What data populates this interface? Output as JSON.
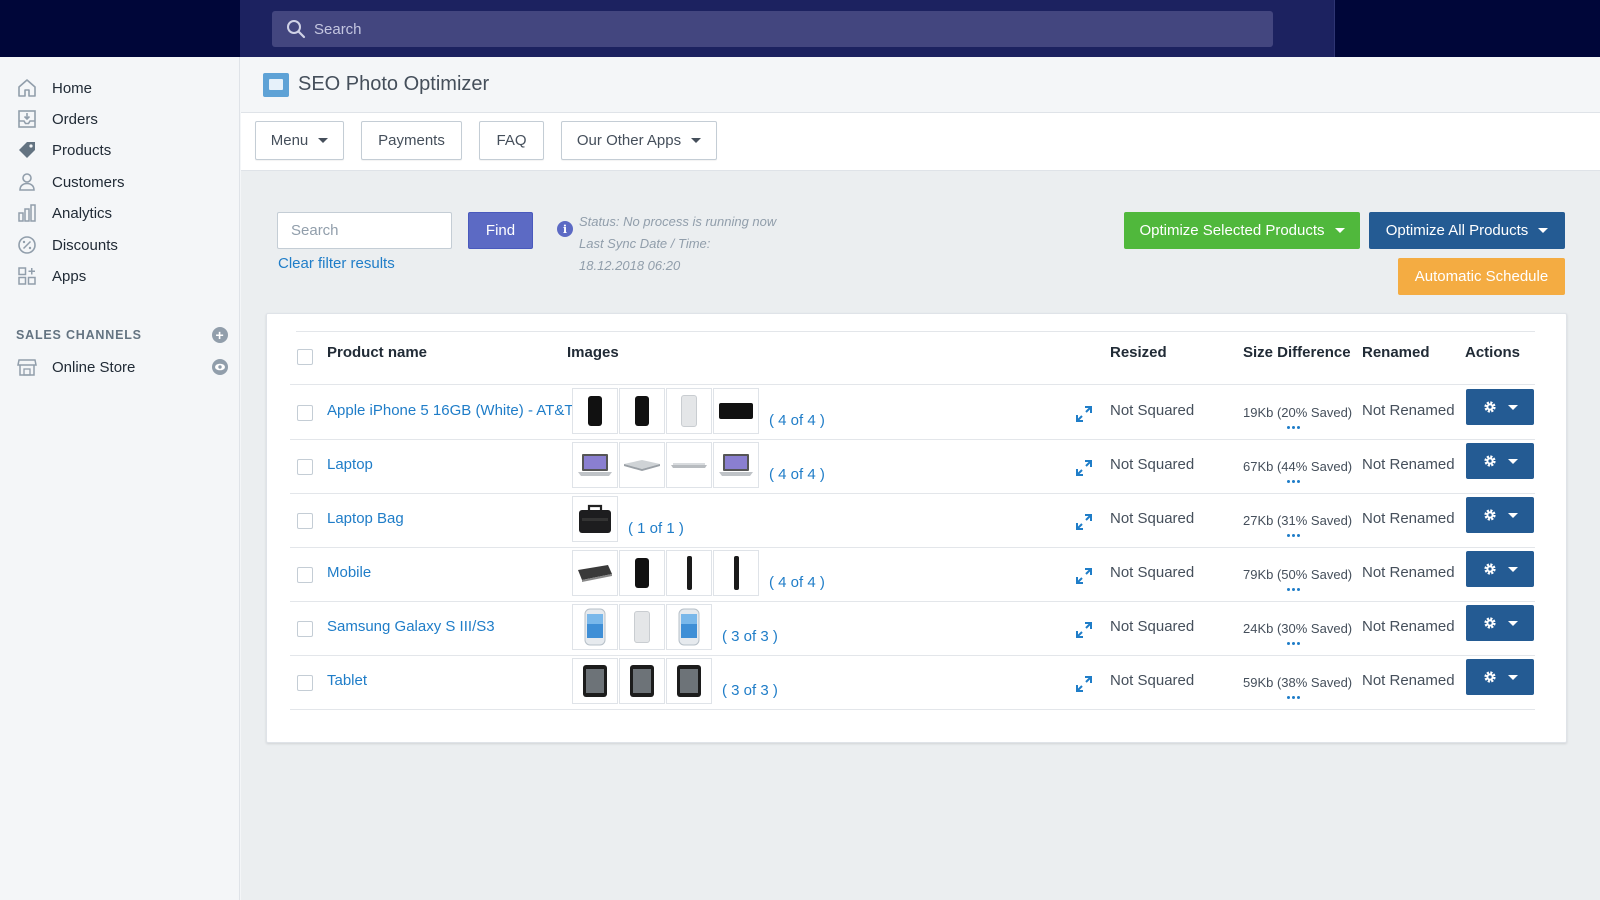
{
  "topbar": {
    "search_placeholder": "Search"
  },
  "sidebar": {
    "items": [
      {
        "label": "Home",
        "icon": "home-icon"
      },
      {
        "label": "Orders",
        "icon": "orders-icon"
      },
      {
        "label": "Products",
        "icon": "tag-icon"
      },
      {
        "label": "Customers",
        "icon": "person-icon"
      },
      {
        "label": "Analytics",
        "icon": "bar-chart-icon"
      },
      {
        "label": "Discounts",
        "icon": "discount-icon"
      },
      {
        "label": "Apps",
        "icon": "apps-icon"
      }
    ],
    "sales_channels_label": "SALES CHANNELS",
    "online_store_label": "Online Store"
  },
  "app": {
    "title": "SEO Photo Optimizer"
  },
  "tabs": {
    "menu": "Menu",
    "payments": "Payments",
    "faq": "FAQ",
    "other_apps": "Our Other Apps"
  },
  "filter": {
    "search_placeholder": "Search",
    "find_label": "Find",
    "clear_label": "Clear filter results",
    "status_line": "Status: No process is running now",
    "sync_line": "Last Sync Date / Time:",
    "sync_value": "18.12.2018 06:20"
  },
  "actions": {
    "optimize_selected": "Optimize Selected Products",
    "optimize_all": "Optimize All Products",
    "automatic_schedule": "Automatic Schedule"
  },
  "colors": {
    "topbar": "#1c2260",
    "link": "#1f7dc8",
    "green": "#50b83c",
    "blue": "#245b93",
    "orange": "#f4ac42",
    "find": "#5c6ac4"
  },
  "table": {
    "headers": {
      "product_name": "Product name",
      "images": "Images",
      "resized": "Resized",
      "size_difference": "Size Difference",
      "renamed": "Renamed",
      "actions": "Actions"
    },
    "rows": [
      {
        "name": "Apple iPhone 5 16GB (White) - AT&T",
        "images": "( 4 of 4 )",
        "thumbs": [
          "phone-black",
          "phone-black",
          "phone-silver",
          "phone-landscape"
        ],
        "resized": "Not Squared",
        "size": "19Kb (20% Saved)",
        "renamed": "Not Renamed"
      },
      {
        "name": "Laptop",
        "images": "( 4 of 4 )",
        "thumbs": [
          "laptop-open",
          "laptop-flat",
          "laptop-thin",
          "laptop-open"
        ],
        "resized": "Not Squared",
        "size": "67Kb (44% Saved)",
        "renamed": "Not Renamed"
      },
      {
        "name": "Laptop Bag",
        "images": "( 1 of 1 )",
        "thumbs": [
          "bag"
        ],
        "resized": "Not Squared",
        "size": "27Kb (31% Saved)",
        "renamed": "Not Renamed"
      },
      {
        "name": "Mobile",
        "images": "( 4 of 4 )",
        "thumbs": [
          "phone-side",
          "phone-black",
          "phone-edge",
          "phone-edge"
        ],
        "resized": "Not Squared",
        "size": "79Kb (50% Saved)",
        "renamed": "Not Renamed"
      },
      {
        "name": "Samsung Galaxy S III/S3",
        "images": "( 3 of 3 )",
        "thumbs": [
          "galaxy",
          "phone-silver",
          "galaxy"
        ],
        "resized": "Not Squared",
        "size": "24Kb (30% Saved)",
        "renamed": "Not Renamed"
      },
      {
        "name": "Tablet",
        "images": "( 3 of 3 )",
        "thumbs": [
          "tablet",
          "tablet",
          "tablet"
        ],
        "resized": "Not Squared",
        "size": "59Kb (38% Saved)",
        "renamed": "Not Renamed"
      }
    ]
  }
}
